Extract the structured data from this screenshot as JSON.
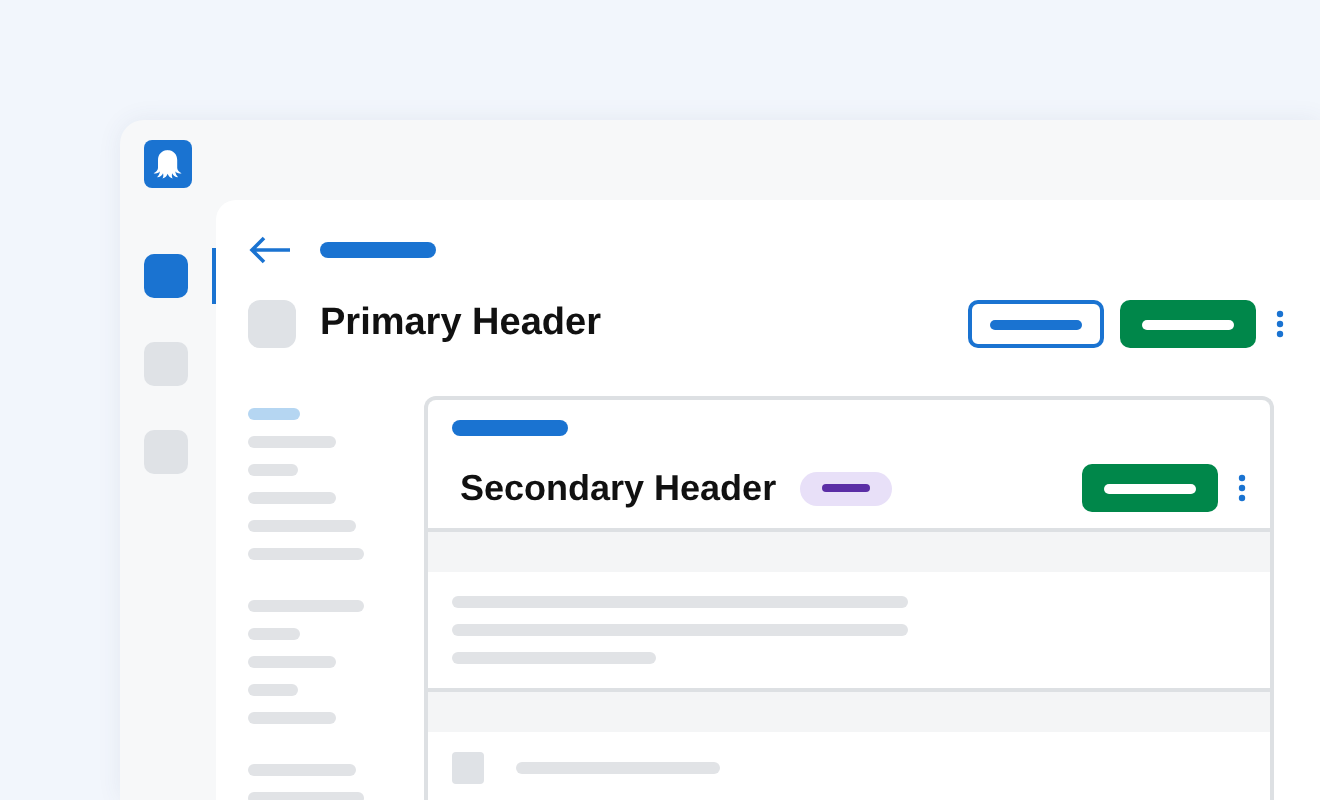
{
  "rail": {
    "items": [
      {
        "selected": true
      },
      {
        "selected": false
      },
      {
        "selected": false
      }
    ]
  },
  "page": {
    "title": "Primary Header"
  },
  "subnav": {
    "groups": [
      {
        "items": [
          {
            "selected": true
          },
          {
            "selected": false
          },
          {
            "selected": false
          },
          {
            "selected": false
          },
          {
            "selected": false
          },
          {
            "selected": false
          }
        ]
      },
      {
        "items": [
          {
            "selected": false
          },
          {
            "selected": false
          },
          {
            "selected": false
          },
          {
            "selected": false
          },
          {
            "selected": false
          }
        ]
      },
      {
        "items": [
          {
            "selected": false
          },
          {
            "selected": false
          }
        ]
      }
    ]
  },
  "card": {
    "title": "Secondary Header"
  }
}
